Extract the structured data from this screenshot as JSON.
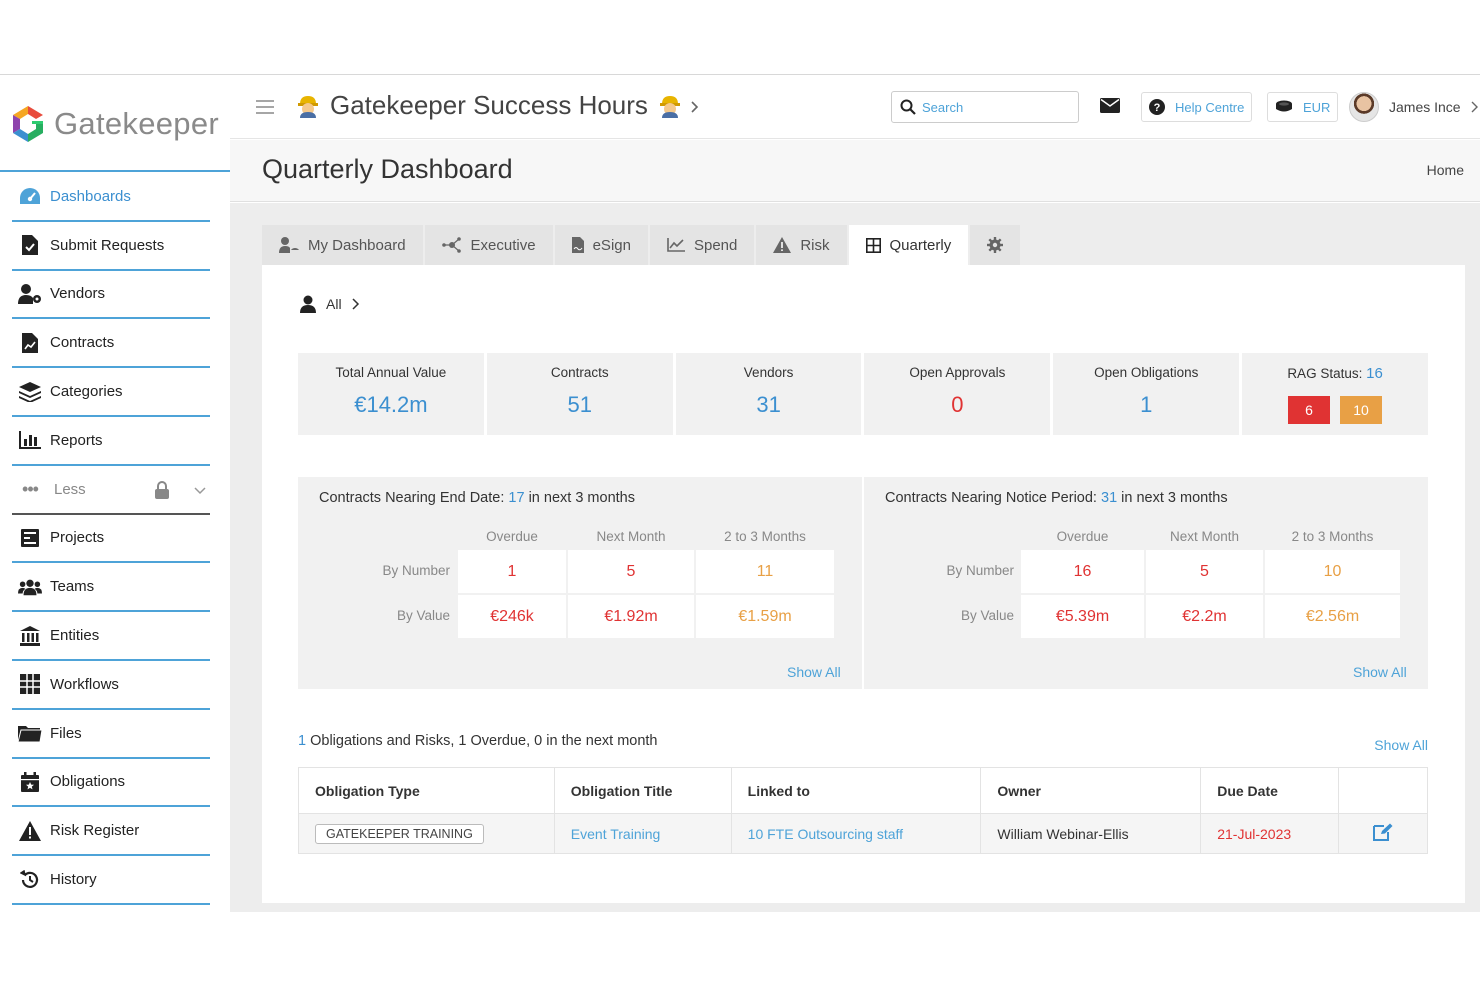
{
  "app": {
    "name": "Gatekeeper"
  },
  "colors": {
    "accent": "#4ea3d8",
    "red": "#e03333",
    "orange": "#e8a045"
  },
  "sidebar": {
    "items": [
      {
        "label": "Dashboards",
        "icon": "dashboard-gauge-icon",
        "active": true
      },
      {
        "label": "Submit Requests",
        "icon": "file-check-icon"
      },
      {
        "label": "Vendors",
        "icon": "user-gear-icon"
      },
      {
        "label": "Contracts",
        "icon": "file-chart-icon"
      },
      {
        "label": "Categories",
        "icon": "layers-icon"
      },
      {
        "label": "Reports",
        "icon": "bar-chart-icon"
      },
      {
        "label": "Less",
        "icon": "ellipsis-icon"
      },
      {
        "label": "Projects",
        "icon": "project-board-icon"
      },
      {
        "label": "Teams",
        "icon": "users-icon"
      },
      {
        "label": "Entities",
        "icon": "building-columns-icon"
      },
      {
        "label": "Workflows",
        "icon": "grid-table-icon"
      },
      {
        "label": "Files",
        "icon": "folder-icon"
      },
      {
        "label": "Obligations",
        "icon": "calendar-star-icon"
      },
      {
        "label": "Risk Register",
        "icon": "warning-triangle-icon"
      },
      {
        "label": "History",
        "icon": "history-icon"
      }
    ]
  },
  "header": {
    "title": "Gatekeeper Success Hours",
    "search_placeholder": "Search",
    "help_label": "Help Centre",
    "currency": "EUR",
    "user_name": "James Ince"
  },
  "page": {
    "title": "Quarterly Dashboard",
    "breadcrumb": "Home"
  },
  "tabs": [
    {
      "label": "My Dashboard",
      "icon": "user-dashboard-icon"
    },
    {
      "label": "Executive",
      "icon": "network-icon"
    },
    {
      "label": "eSign",
      "icon": "file-sign-icon"
    },
    {
      "label": "Spend",
      "icon": "line-chart-icon"
    },
    {
      "label": "Risk",
      "icon": "warning-icon"
    },
    {
      "label": "Quarterly",
      "icon": "grid-icon",
      "active": true
    },
    {
      "label": "",
      "icon": "gear-icon"
    }
  ],
  "filter": {
    "label": "All"
  },
  "kpis": [
    {
      "label": "Total Annual Value",
      "value": "€14.2m"
    },
    {
      "label": "Contracts",
      "value": "51"
    },
    {
      "label": "Vendors",
      "value": "31"
    },
    {
      "label": "Open Approvals",
      "value": "0"
    },
    {
      "label": "Open Obligations",
      "value": "1"
    }
  ],
  "rag": {
    "label": "RAG Status:",
    "count": "16",
    "red": "6",
    "amber": "10"
  },
  "end_date": {
    "prefix": "Contracts Nearing End Date:",
    "count": "17",
    "suffix": "in next 3 months",
    "columns": [
      "Overdue",
      "Next Month",
      "2 to 3 Months"
    ],
    "rows": [
      {
        "label": "By Number",
        "values": [
          "1",
          "5",
          "11"
        ]
      },
      {
        "label": "By Value",
        "values": [
          "€246k",
          "€1.92m",
          "€1.59m"
        ]
      }
    ],
    "show_all": "Show All"
  },
  "notice": {
    "prefix": "Contracts Nearing Notice Period:",
    "count": "31",
    "suffix": "in next 3 months",
    "columns": [
      "Overdue",
      "Next Month",
      "2 to 3 Months"
    ],
    "rows": [
      {
        "label": "By Number",
        "values": [
          "16",
          "5",
          "10"
        ]
      },
      {
        "label": "By Value",
        "values": [
          "€5.39m",
          "€2.2m",
          "€2.56m"
        ]
      }
    ],
    "show_all": "Show All"
  },
  "obligations": {
    "count": "1",
    "summary": "Obligations and Risks, 1 Overdue, 0 in the next month",
    "show_all": "Show All",
    "headers": [
      "Obligation Type",
      "Obligation Title",
      "Linked to",
      "Owner",
      "Due Date"
    ],
    "rows": [
      {
        "type": "GATEKEEPER TRAINING",
        "title": "Event Training",
        "linked": "10 FTE Outsourcing staff",
        "owner": "William Webinar-Ellis",
        "due": "21-Jul-2023"
      }
    ]
  }
}
